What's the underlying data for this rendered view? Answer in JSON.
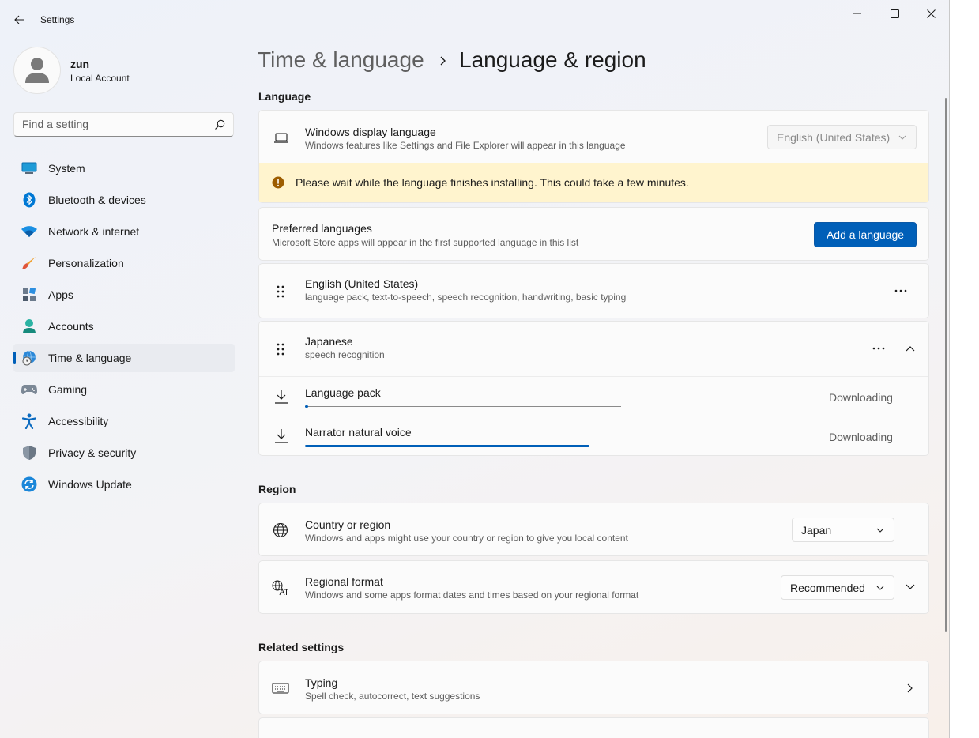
{
  "window": {
    "title": "Settings"
  },
  "user": {
    "name": "zun",
    "account_type": "Local Account"
  },
  "search": {
    "placeholder": "Find a setting"
  },
  "nav": [
    {
      "label": "System",
      "icon": "monitor-icon"
    },
    {
      "label": "Bluetooth & devices",
      "icon": "bluetooth-icon"
    },
    {
      "label": "Network & internet",
      "icon": "wifi-icon"
    },
    {
      "label": "Personalization",
      "icon": "brush-icon"
    },
    {
      "label": "Apps",
      "icon": "apps-icon"
    },
    {
      "label": "Accounts",
      "icon": "person-icon"
    },
    {
      "label": "Time & language",
      "icon": "globe-clock-icon",
      "active": true
    },
    {
      "label": "Gaming",
      "icon": "gamepad-icon"
    },
    {
      "label": "Accessibility",
      "icon": "accessibility-icon"
    },
    {
      "label": "Privacy & security",
      "icon": "shield-icon"
    },
    {
      "label": "Windows Update",
      "icon": "update-icon"
    }
  ],
  "breadcrumb": {
    "parent": "Time & language",
    "current": "Language & region"
  },
  "language": {
    "heading": "Language",
    "display_language": {
      "title": "Windows display language",
      "subtitle": "Windows features like Settings and File Explorer will appear in this language",
      "value": "English (United States)"
    },
    "warning": "Please wait while the language finishes installing. This could take a few minutes.",
    "preferred": {
      "title": "Preferred languages",
      "subtitle": "Microsoft Store apps will appear in the first supported language in this list",
      "add_button": "Add a language"
    },
    "languages": [
      {
        "name": "English (United States)",
        "features": "language pack, text-to-speech, speech recognition, handwriting, basic typing"
      },
      {
        "name": "Japanese",
        "features": "speech recognition"
      }
    ],
    "downloads": [
      {
        "name": "Language pack",
        "status": "Downloading",
        "progress": 0.01
      },
      {
        "name": "Narrator natural voice",
        "status": "Downloading",
        "progress": 0.9
      }
    ]
  },
  "region": {
    "heading": "Region",
    "country": {
      "title": "Country or region",
      "subtitle": "Windows and apps might use your country or region to give you local content",
      "value": "Japan"
    },
    "format": {
      "title": "Regional format",
      "subtitle": "Windows and some apps format dates and times based on your regional format",
      "value": "Recommended"
    }
  },
  "related": {
    "heading": "Related settings",
    "typing": {
      "title": "Typing",
      "subtitle": "Spell check, autocorrect, text suggestions"
    }
  },
  "colors": {
    "accent": "#005fb8",
    "warning_bg": "#fff4ce",
    "warning_icon": "#9d5d00"
  }
}
